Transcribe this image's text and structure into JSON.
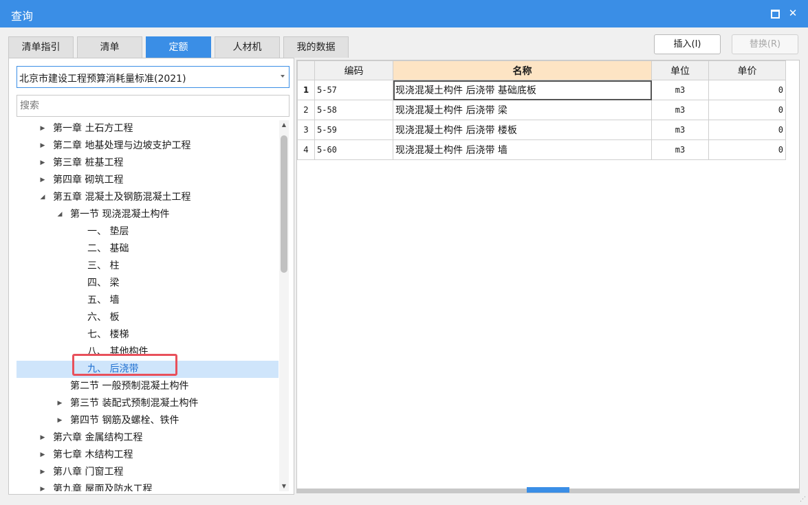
{
  "window": {
    "title": "查询"
  },
  "tabs": [
    "清单指引",
    "清单",
    "定额",
    "人材机",
    "我的数据"
  ],
  "active_tab": "定额",
  "toolbar": {
    "insert_label": "插入(I)",
    "replace_label": "替换(R)"
  },
  "left": {
    "standard_select": "北京市建设工程预算消耗量标准(2021)",
    "search_placeholder": "搜索",
    "tree": [
      {
        "label": "第一章 土石方工程",
        "level": 0,
        "arrow": "collapsed"
      },
      {
        "label": "第二章 地基处理与边坡支护工程",
        "level": 0,
        "arrow": "collapsed"
      },
      {
        "label": "第三章 桩基工程",
        "level": 0,
        "arrow": "collapsed"
      },
      {
        "label": "第四章 砌筑工程",
        "level": 0,
        "arrow": "collapsed"
      },
      {
        "label": "第五章 混凝土及钢筋混凝土工程",
        "level": 0,
        "arrow": "expanded"
      },
      {
        "label": "第一节 现浇混凝土构件",
        "level": 1,
        "arrow": "expanded"
      },
      {
        "label": "一、 垫层",
        "level": 2,
        "arrow": "none"
      },
      {
        "label": "二、 基础",
        "level": 2,
        "arrow": "none"
      },
      {
        "label": "三、 柱",
        "level": 2,
        "arrow": "none"
      },
      {
        "label": "四、 梁",
        "level": 2,
        "arrow": "none"
      },
      {
        "label": "五、 墙",
        "level": 2,
        "arrow": "none"
      },
      {
        "label": "六、 板",
        "level": 2,
        "arrow": "none"
      },
      {
        "label": "七、 楼梯",
        "level": 2,
        "arrow": "none"
      },
      {
        "label": "八、 其他构件",
        "level": 2,
        "arrow": "none"
      },
      {
        "label": "九、 后浇带",
        "level": 2,
        "arrow": "none",
        "selected": true
      },
      {
        "label": "第二节 一般预制混凝土构件",
        "level": 1,
        "arrow": "none"
      },
      {
        "label": "第三节 装配式预制混凝土构件",
        "level": 1,
        "arrow": "collapsed"
      },
      {
        "label": "第四节 钢筋及螺栓、铁件",
        "level": 1,
        "arrow": "collapsed"
      },
      {
        "label": "第六章 金属结构工程",
        "level": 0,
        "arrow": "collapsed"
      },
      {
        "label": "第七章 木结构工程",
        "level": 0,
        "arrow": "collapsed"
      },
      {
        "label": "第八章 门窗工程",
        "level": 0,
        "arrow": "collapsed"
      },
      {
        "label": "第九章 屋面及防水工程",
        "level": 0,
        "arrow": "collapsed"
      }
    ]
  },
  "grid": {
    "headers": {
      "code": "编码",
      "name": "名称",
      "unit": "单位",
      "price": "单价"
    },
    "rows": [
      {
        "num": "1",
        "code": "5-57",
        "name": "现浇混凝土构件 后浇带 基础底板",
        "unit": "m3",
        "price": "0"
      },
      {
        "num": "2",
        "code": "5-58",
        "name": "现浇混凝土构件 后浇带 梁",
        "unit": "m3",
        "price": "0"
      },
      {
        "num": "3",
        "code": "5-59",
        "name": "现浇混凝土构件 后浇带 楼板",
        "unit": "m3",
        "price": "0"
      },
      {
        "num": "4",
        "code": "5-60",
        "name": "现浇混凝土构件 后浇带 墙",
        "unit": "m3",
        "price": "0"
      }
    ]
  },
  "colors": {
    "accent": "#3a8ee6",
    "header_highlight": "#fde4c4",
    "selection": "#cfe5fb",
    "callout": "#e8505b"
  }
}
